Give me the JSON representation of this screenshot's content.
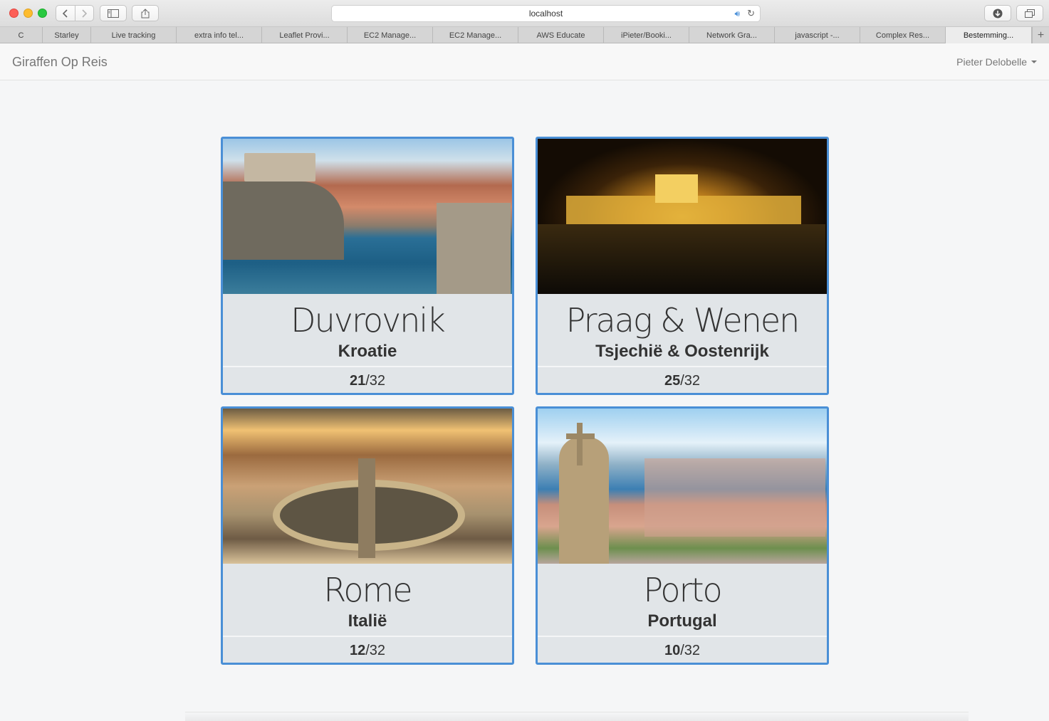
{
  "browser": {
    "address": "localhost",
    "tabs": [
      {
        "label": "C",
        "width": 60
      },
      {
        "label": "Starley",
        "width": 68
      },
      {
        "label": "Live tracking",
        "width": 120
      },
      {
        "label": "extra info tel...",
        "width": 120
      },
      {
        "label": "Leaflet Provi...",
        "width": 120
      },
      {
        "label": "EC2 Manage...",
        "width": 120
      },
      {
        "label": "EC2 Manage...",
        "width": 120
      },
      {
        "label": "AWS Educate",
        "width": 120
      },
      {
        "label": "iPieter/Booki...",
        "width": 120
      },
      {
        "label": "Network Gra...",
        "width": 120
      },
      {
        "label": "javascript -...",
        "width": 120
      },
      {
        "label": "Complex Res...",
        "width": 120
      },
      {
        "label": "Bestemming...",
        "width": 121,
        "active": true
      }
    ]
  },
  "app": {
    "brand": "Giraffen Op Reis",
    "user": "Pieter Delobelle"
  },
  "destinations": [
    {
      "city": "Duvrovnik",
      "country": "Kroatie",
      "count": "21",
      "total": "/32"
    },
    {
      "city": "Praag & Wenen",
      "country": "Tsjechië & Oostenrijk",
      "count": "25",
      "total": "/32"
    },
    {
      "city": "Rome",
      "country": "Italië",
      "count": "12",
      "total": "/32"
    },
    {
      "city": "Porto",
      "country": "Portugal",
      "count": "10",
      "total": "/32"
    }
  ]
}
